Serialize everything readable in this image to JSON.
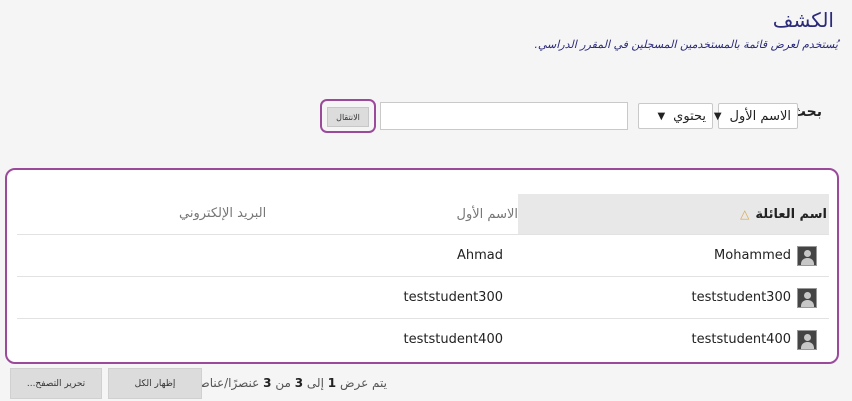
{
  "page": {
    "title": "الكشف",
    "subtitle": "يُستخدم لعرض قائمة بالمستخدمين المسجلين في المقرر الدراسي."
  },
  "search": {
    "label": "بحث",
    "field_select": "الاسم الأول",
    "operator_select": "يحتوي",
    "input_value": "",
    "go_button": "الانتقال"
  },
  "table": {
    "headers": {
      "last_name": "اسم العائلة",
      "first_name": "الاسم الأول",
      "email": "البريد الإلكتروني"
    },
    "sort_icon": "sort-ascending-triangle",
    "rows": [
      {
        "last_name": "Mohammed",
        "first_name": "Ahmad",
        "email": ""
      },
      {
        "last_name": "teststudent300",
        "first_name": "teststudent300",
        "email": ""
      },
      {
        "last_name": "teststudent400",
        "first_name": "teststudent400",
        "email": ""
      }
    ]
  },
  "footer": {
    "show_all": "إظهار الكل",
    "edit_paging": "تحرير التصفح...",
    "paging_prefix": "يتم عرض",
    "paging_from": "1",
    "paging_to_word": "إلى",
    "paging_to": "3",
    "paging_of_word": "من",
    "paging_total": "3",
    "paging_suffix": "عنصرًا/عناصر"
  },
  "colors": {
    "highlight_border": "#9b4a9b",
    "title": "#2b2b7a",
    "sorted_header_bg": "#e8e8e8",
    "sort_icon": "#d7a94e"
  }
}
